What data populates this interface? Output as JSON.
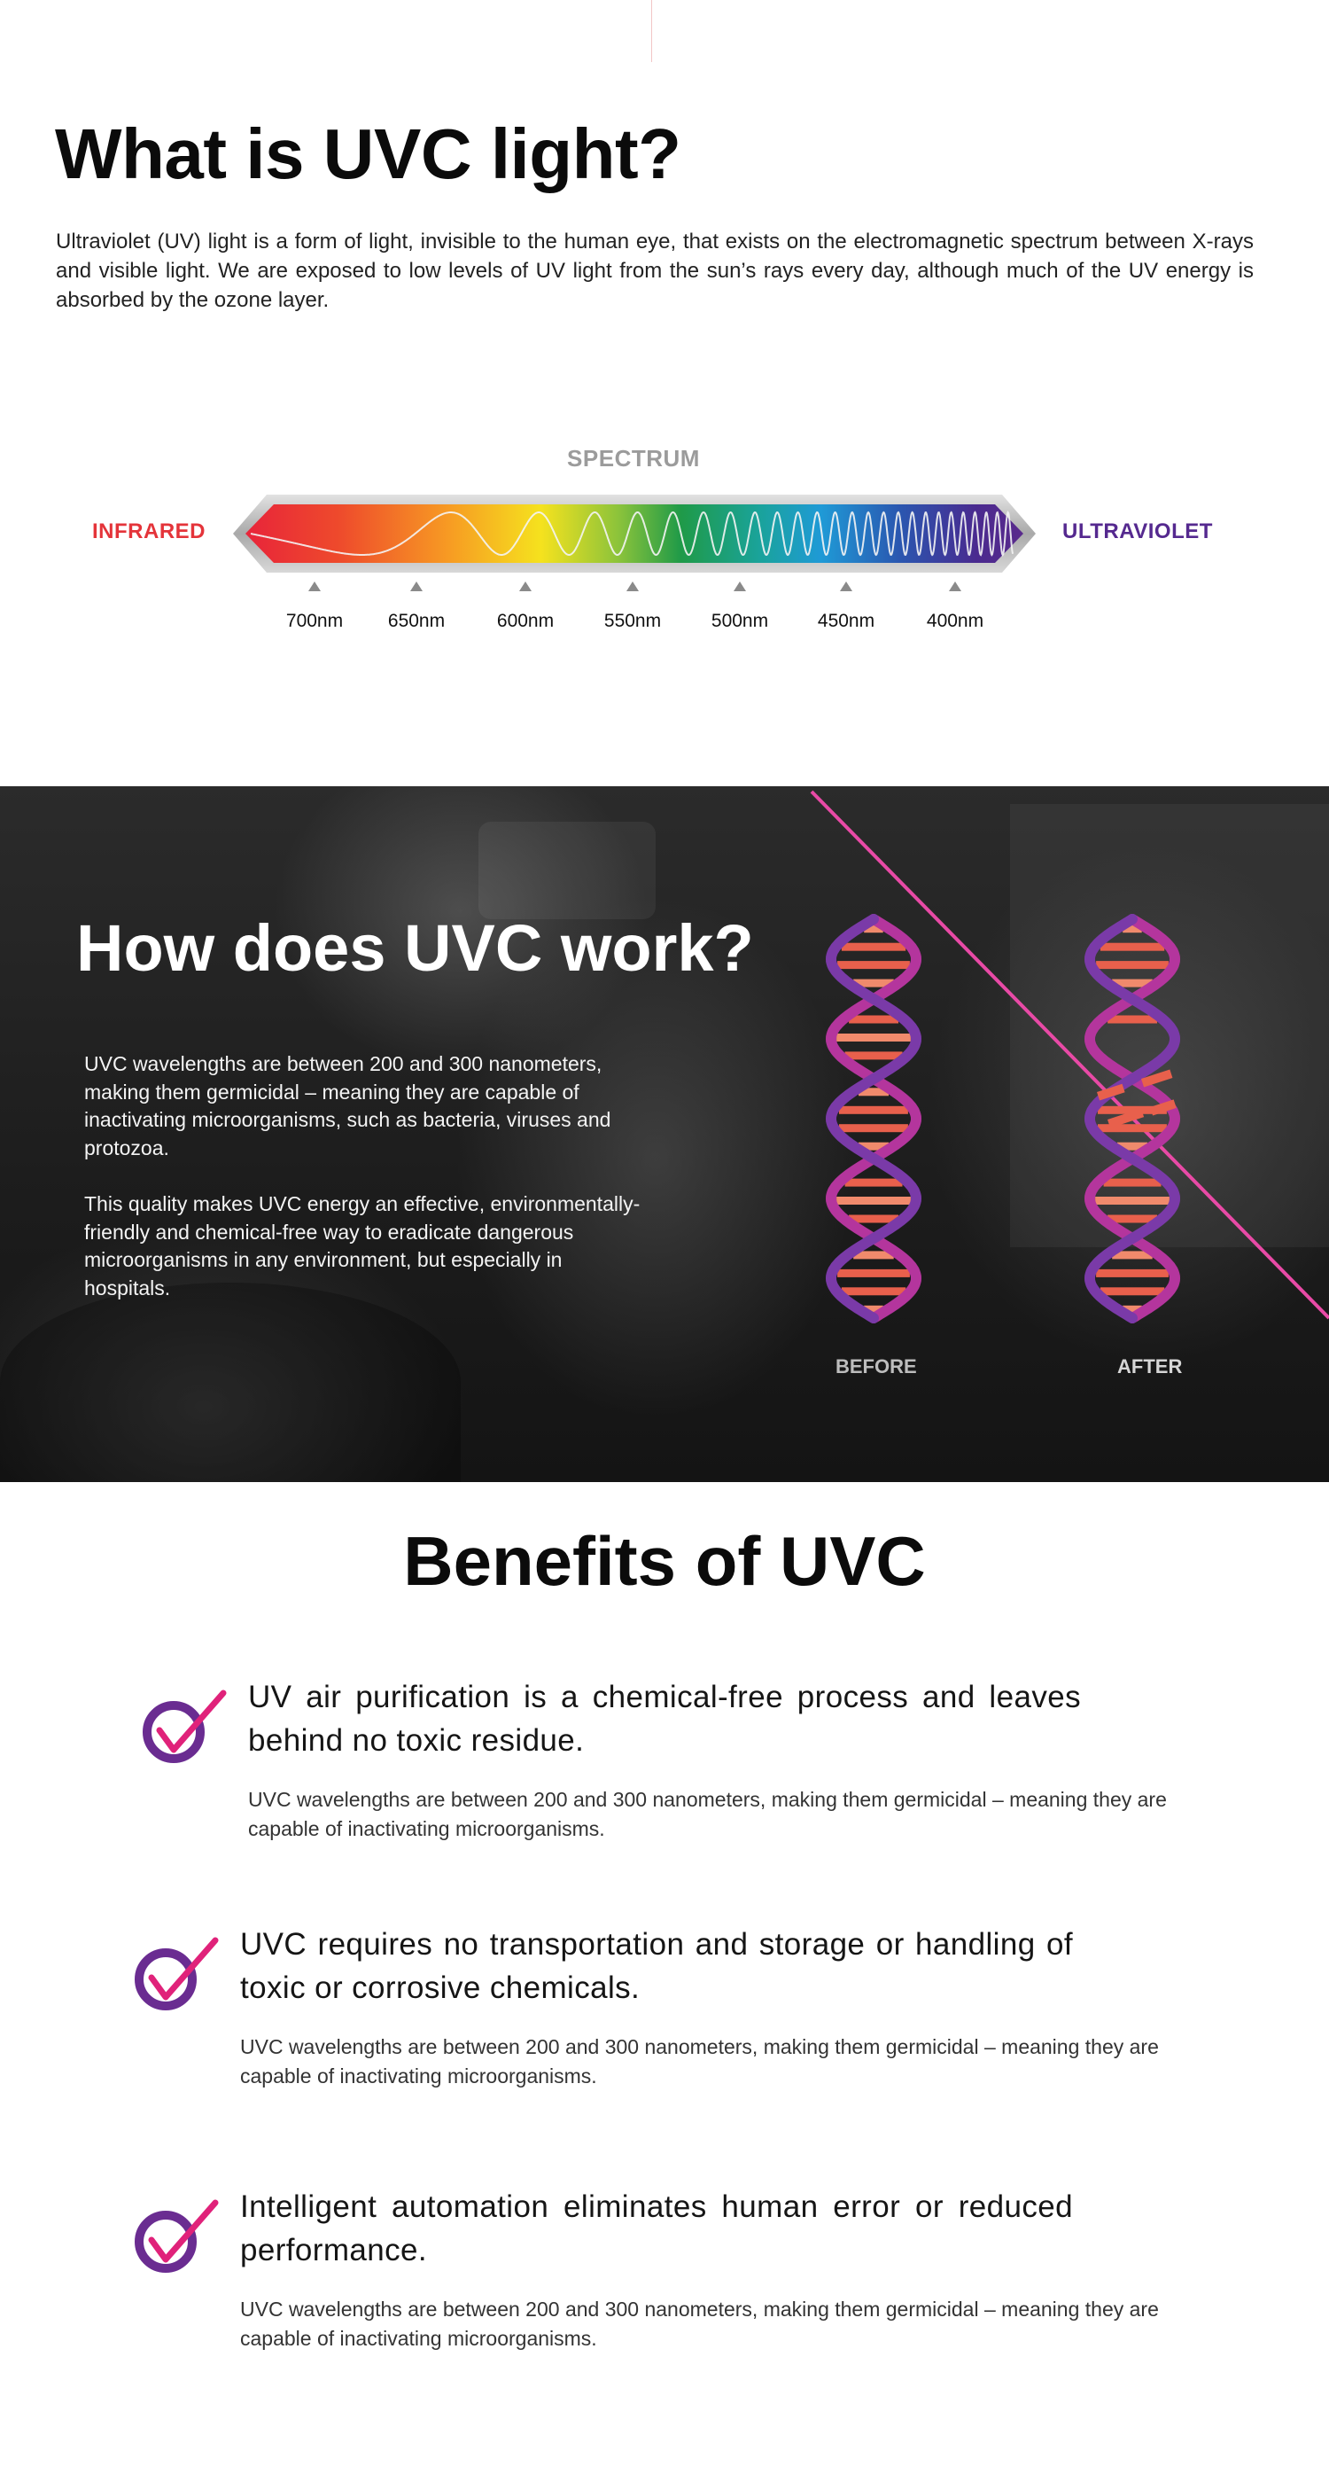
{
  "section1": {
    "title": "What is UVC light?",
    "text": "Ultraviolet (UV) light is a form of light, invisible to the human eye, that exists on the electromagnetic spectrum between X-rays and visible light. We are exposed to low levels of UV light from the sun’s rays every day, although much of the UV energy is absorbed by the ozone layer.",
    "spectrum": {
      "label": "SPECTRUM",
      "left_label": "INFRARED",
      "right_label": "ULTRAVIOLET",
      "ticks": [
        "700nm",
        "650nm",
        "600nm",
        "550nm",
        "500nm",
        "450nm",
        "400nm"
      ]
    }
  },
  "section2": {
    "title": "How does UVC work?",
    "p1": "UVC wavelengths are between 200 and 300 nanometers, making them germicidal – meaning they are capable of inactivating microorganisms, such as bacteria, viruses and protozoa.",
    "p2": "This quality makes UVC energy an effective, environmentally-friendly and chemical-free way to eradicate dangerous microorganisms in any environment, but especially in hospitals.",
    "before_label": "BEFORE",
    "after_label": "AFTER"
  },
  "section3": {
    "title": "Benefits of UVC",
    "benefits": [
      {
        "heading": "UV air purification is a chemical-free process and leaves behind no toxic residue.",
        "desc": "UVC wavelengths are between 200 and 300 nanometers, making them germicidal – meaning they are capable of inactivating microorganisms."
      },
      {
        "heading": "UVC requires no transportation and storage or handling of toxic or corrosive chemicals.",
        "desc": "UVC wavelengths are between 200 and 300 nanometers, making them germicidal – meaning they are capable of inactivating microorganisms."
      },
      {
        "heading": "Intelligent automation eliminates human error or reduced performance.",
        "desc": "UVC wavelengths are between 200 and 300 nanometers, making them germicidal – meaning they are capable of inactivating microorganisms."
      }
    ]
  },
  "colors": {
    "infrared": "#e4343a",
    "ultraviolet": "#55298f",
    "check_circle": "#6a2c91",
    "check_mark": "#e0227a",
    "dna_magenta": "#b4359d",
    "dna_orange": "#e8604c"
  },
  "icons": [
    "check-icon",
    "dna-icon",
    "spectrum-wave-icon"
  ]
}
